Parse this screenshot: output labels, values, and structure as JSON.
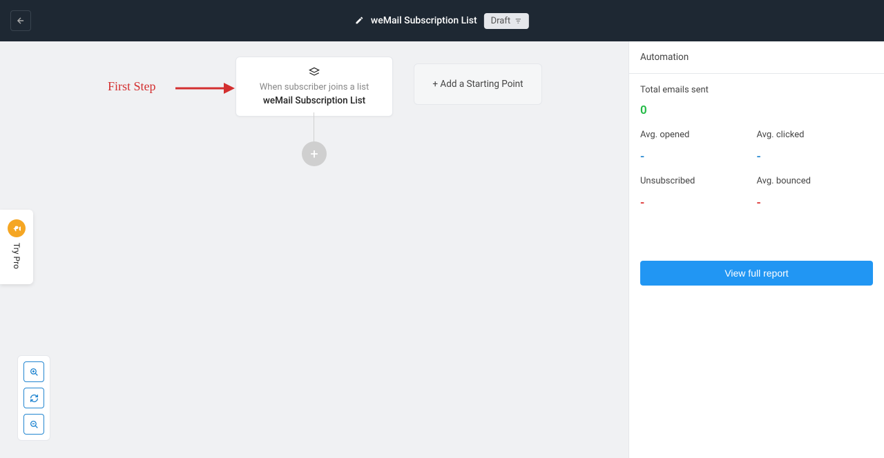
{
  "header": {
    "title": "weMail Subscription List",
    "status_badge": "Draft"
  },
  "annotation": {
    "label": "First Step"
  },
  "canvas": {
    "node": {
      "subtitle": "When subscriber joins a list",
      "title": "weMail Subscription List"
    },
    "add_starting_label": "+ Add a Starting Point"
  },
  "sidebar": {
    "header": "Automation",
    "total_sent_label": "Total emails sent",
    "total_sent_value": "0",
    "avg_opened_label": "Avg. opened",
    "avg_opened_value": "-",
    "avg_clicked_label": "Avg. clicked",
    "avg_clicked_value": "-",
    "unsubscribed_label": "Unsubscribed",
    "unsubscribed_value": "-",
    "avg_bounced_label": "Avg. bounced",
    "avg_bounced_value": "-",
    "view_report_label": "View full report"
  },
  "try_pro": {
    "label": "Try Pro"
  }
}
